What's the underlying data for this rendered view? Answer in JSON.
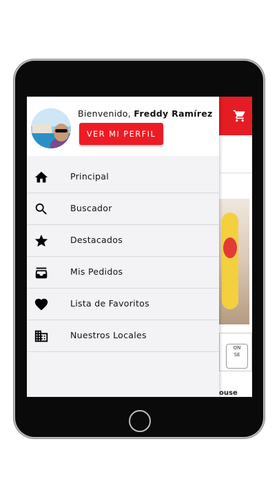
{
  "drawer": {
    "welcome_prefix": "Bienvenido, ",
    "user_name": "Freddy Ramírez",
    "profile_button": "VER MI PERFIL",
    "items": [
      {
        "label": "Principal",
        "icon": "home-icon"
      },
      {
        "label": "Buscador",
        "icon": "search-icon"
      },
      {
        "label": "Destacados",
        "icon": "star-icon"
      },
      {
        "label": "Mis Pedidos",
        "icon": "inbox-icon"
      },
      {
        "label": "Lista de Favoritos",
        "icon": "heart-icon"
      },
      {
        "label": "Nuestros Locales",
        "icon": "building-icon"
      }
    ]
  },
  "background_app": {
    "logo_text": "ON\nSE",
    "caption": "ouse"
  },
  "colors": {
    "brand_red": "#ee1b24",
    "drawer_bg": "#f3f3f6"
  }
}
